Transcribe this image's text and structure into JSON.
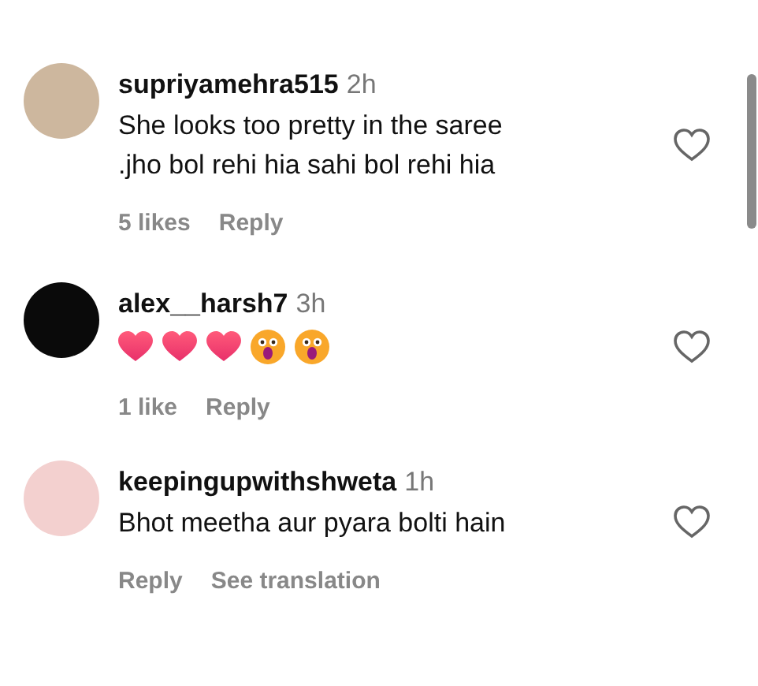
{
  "comments": [
    {
      "username": "supriyamehra515",
      "time": "2h",
      "lines": [
        "She looks too pretty in the saree",
        ".jho bol rehi hia sahi bol rehi hia"
      ],
      "avatar": {
        "color": "#cdb79e"
      },
      "actions": [
        "5 likes",
        "Reply"
      ],
      "liked": false
    },
    {
      "username": "alex__harsh7",
      "time": "3h",
      "emojis": [
        {
          "kind": "heart"
        },
        {
          "kind": "heart"
        },
        {
          "kind": "heart"
        },
        {
          "kind": "surprised"
        },
        {
          "kind": "surprised"
        }
      ],
      "avatar": {
        "color": "#0a0a0a"
      },
      "actions": [
        "1 like",
        "Reply"
      ],
      "liked": false
    },
    {
      "username": "keepingupwithshweta",
      "time": "1h",
      "lines": [
        "Bhot meetha aur pyara bolti hain"
      ],
      "avatar": {
        "color": "#f3d0cf"
      },
      "actions": [
        "Reply",
        "See translation"
      ],
      "liked": false
    }
  ]
}
